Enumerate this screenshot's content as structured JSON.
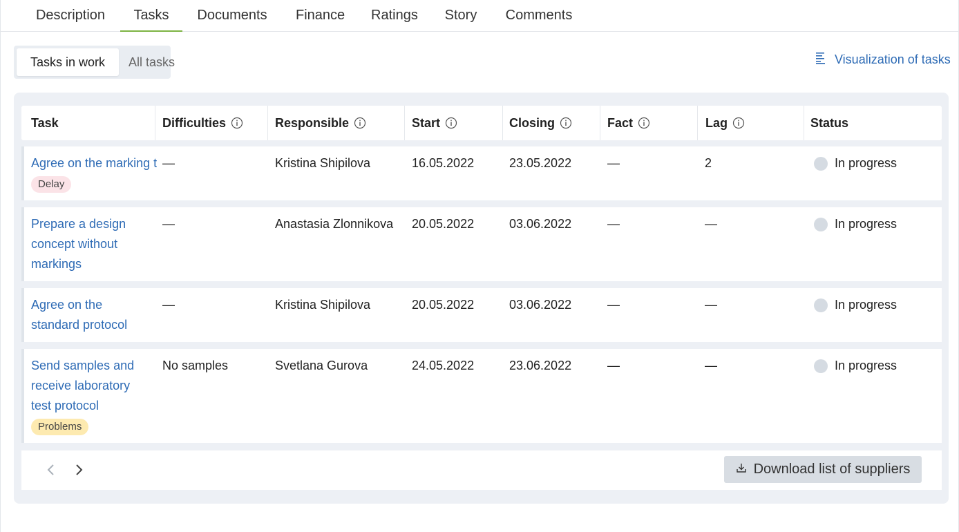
{
  "tabs": [
    {
      "label": "Description"
    },
    {
      "label": "Tasks"
    },
    {
      "label": "Documents"
    },
    {
      "label": "Finance"
    },
    {
      "label": "Ratings"
    },
    {
      "label": "Story"
    },
    {
      "label": "Comments"
    }
  ],
  "active_tab": "Tasks",
  "filter": {
    "in_work_label": "Tasks in work",
    "all_label": "All tasks",
    "selected": "Tasks in work"
  },
  "visualization": {
    "label": "Visualization of tasks",
    "icon": "list-lines-icon"
  },
  "table": {
    "headers": {
      "task": "Task",
      "difficulties": "Difficulties",
      "responsible": "Responsible",
      "start": "Start",
      "closing": "Closing",
      "fact": "Fact",
      "lag": "Lag",
      "status": "Status"
    },
    "rows": [
      {
        "task": "Agree on the marking t",
        "badge": "Delay",
        "difficulties": "—",
        "responsible": "Kristina Shipilova",
        "start": "16.05.2022",
        "closing": "23.05.2022",
        "fact": "—",
        "lag": "2",
        "status": "In progress"
      },
      {
        "task_lines": [
          "Prepare a design",
          "concept without",
          "markings"
        ],
        "difficulties": "—",
        "responsible": "Anastasia Zlonnikova",
        "start": "20.05.2022",
        "closing": "03.06.2022",
        "fact": "—",
        "lag": "—",
        "status": "In progress"
      },
      {
        "task_lines": [
          "Agree on the",
          "standard protocol"
        ],
        "difficulties": "—",
        "responsible": "Kristina Shipilova",
        "start": "20.05.2022",
        "closing": "03.06.2022",
        "fact": "—",
        "lag": "—",
        "status": "In progress"
      },
      {
        "task_lines": [
          "Send samples and",
          "receive laboratory",
          "test protocol"
        ],
        "badge": "Problems",
        "difficulties": "No samples",
        "responsible": "Svetlana Gurova",
        "start": "24.05.2022",
        "closing": "23.06.2022",
        "fact": "—",
        "lag": "—",
        "status": "In progress"
      }
    ]
  },
  "footer": {
    "download_label": "Download list of suppliers",
    "download_icon": "download-icon",
    "prev_icon": "chevron-left-icon",
    "next_icon": "chevron-right-icon"
  },
  "colors": {
    "accent_link": "#2e6bb5",
    "active_tab_underline": "#7cb342",
    "delay_badge": "#fbe3e7",
    "problems_badge": "#fdeab0",
    "status_dot": "#d5dbe2"
  }
}
